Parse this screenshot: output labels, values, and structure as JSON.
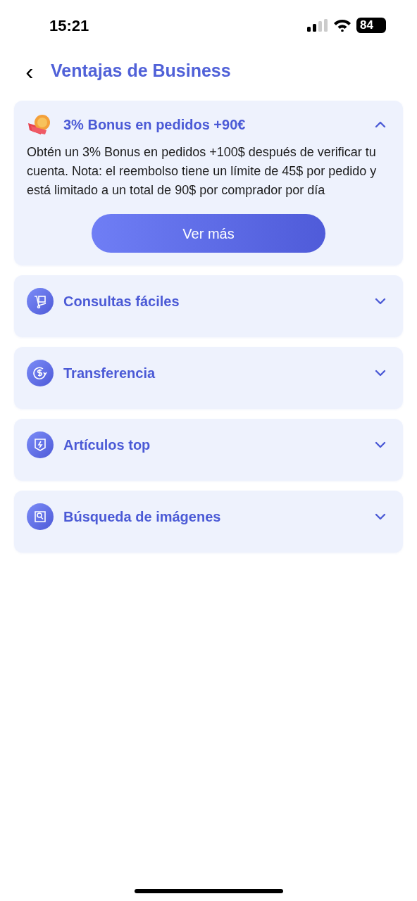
{
  "status_bar": {
    "time": "15:21",
    "battery": "84"
  },
  "header": {
    "back": "‹",
    "title": "Ventajas de Business"
  },
  "items": [
    {
      "kind": "badge",
      "title": "3% Bonus en pedidos +90€",
      "expanded": true,
      "body": "Obtén un 3% Bonus en pedidos +100$ después de verificar tu cuenta. Nota: el reembolso tiene un límite de 45$ por pedido y está limitado a un total de 90$ por comprador por día",
      "button": "Ver más"
    },
    {
      "kind": "cart",
      "title": "Consultas fáciles",
      "expanded": false
    },
    {
      "kind": "transfer",
      "title": "Transferencia",
      "expanded": false
    },
    {
      "kind": "shield",
      "title": "Artículos top",
      "expanded": false
    },
    {
      "kind": "image-search",
      "title": "Búsqueda de imágenes",
      "expanded": false
    }
  ]
}
